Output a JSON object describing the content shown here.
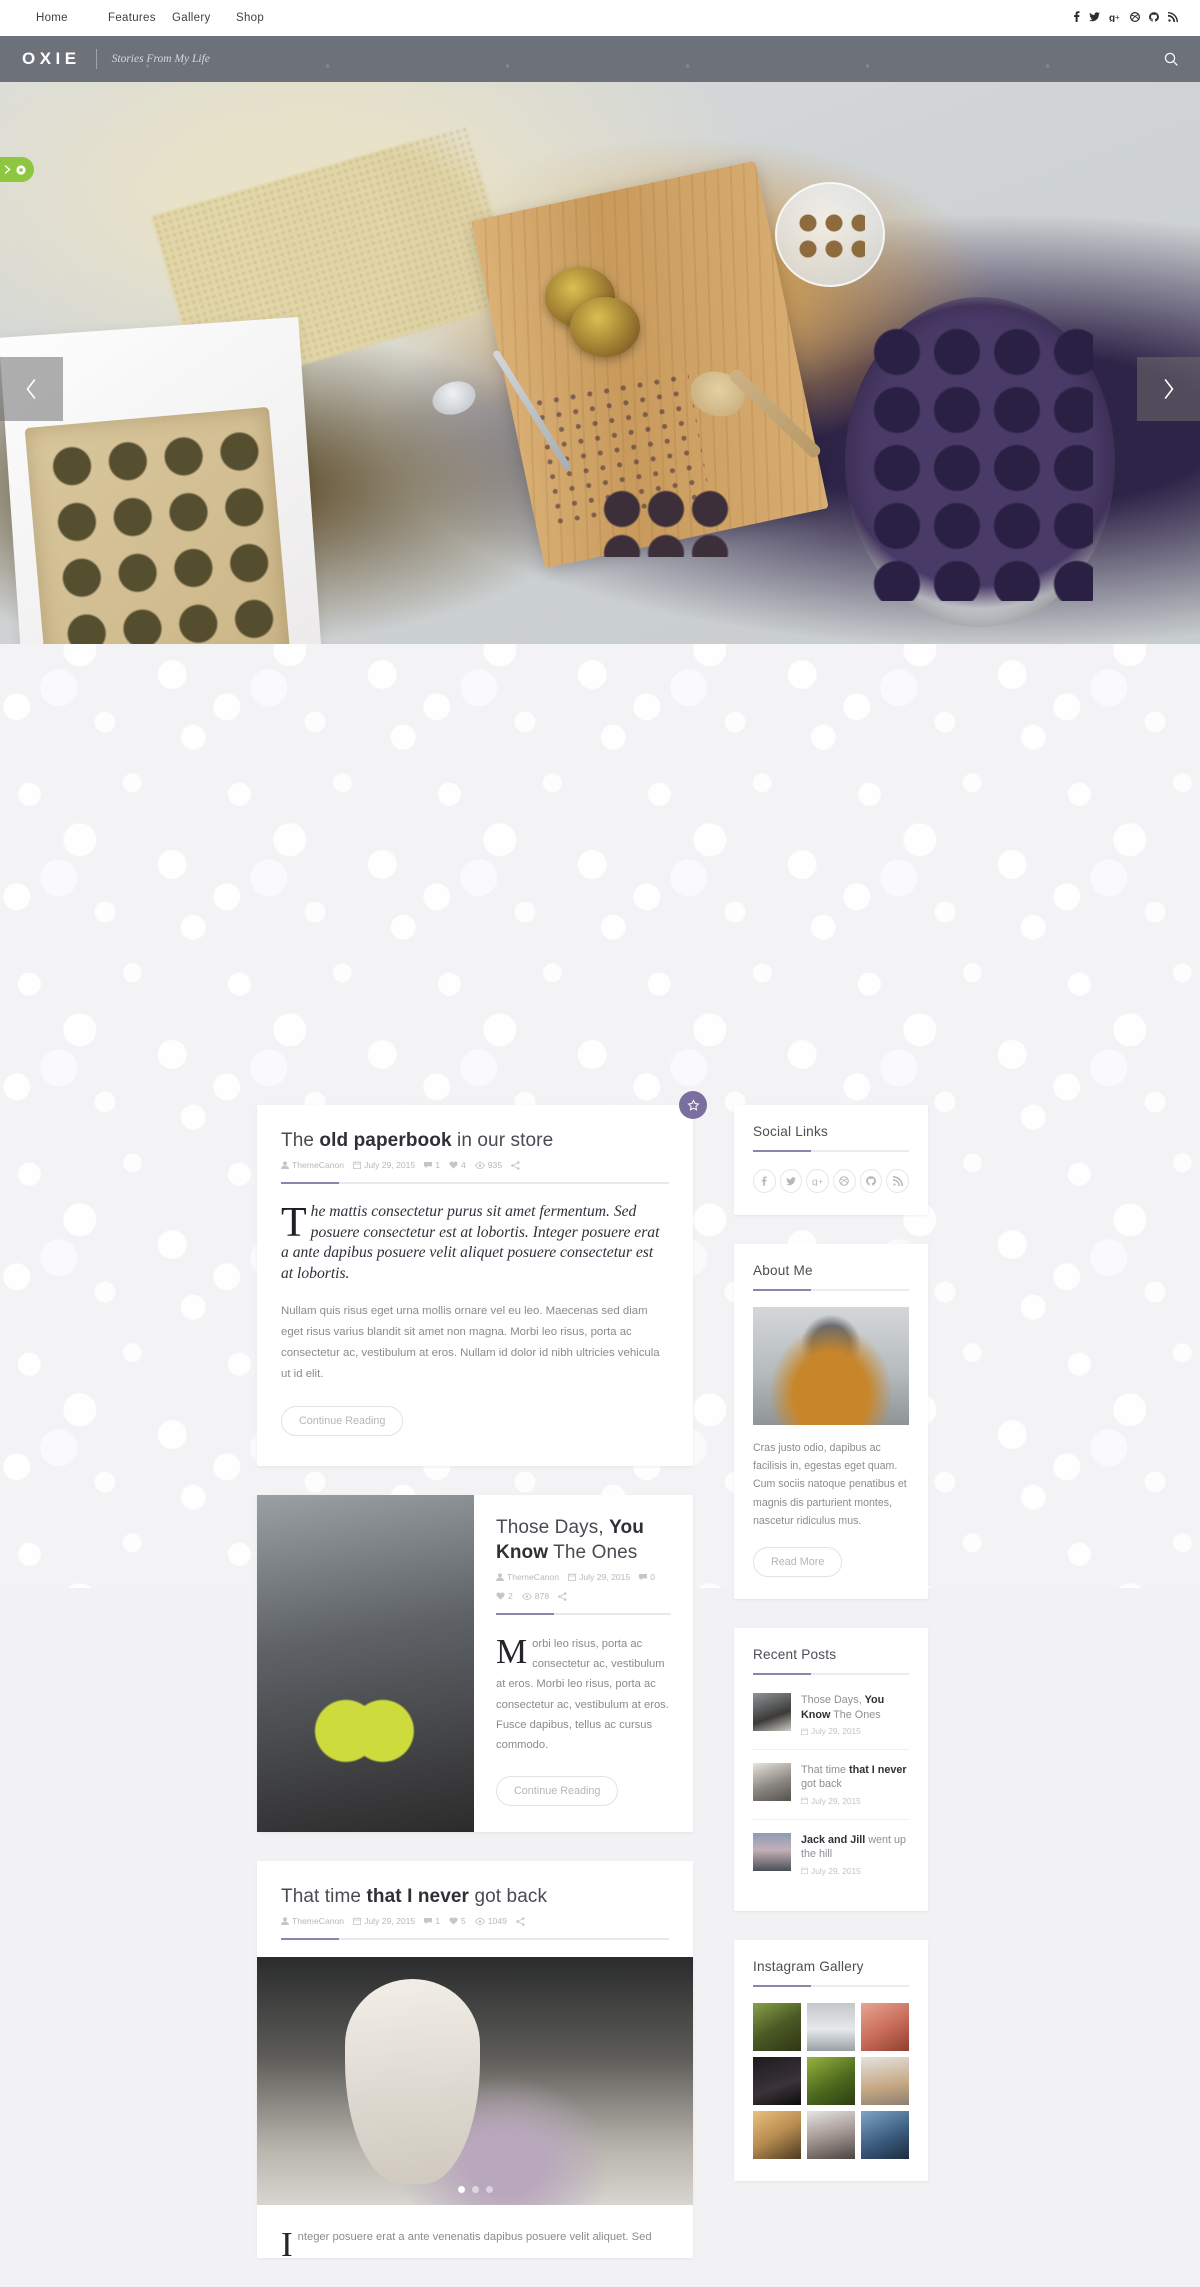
{
  "topnav": {
    "items": [
      {
        "label": "Home"
      },
      {
        "label": "Features"
      },
      {
        "label": "Gallery"
      },
      {
        "label": "Shop"
      }
    ],
    "social": [
      {
        "name": "facebook-icon",
        "glyph": "f"
      },
      {
        "name": "twitter-icon",
        "glyph": "ᵛ"
      },
      {
        "name": "google-plus-icon",
        "glyph": "g+"
      },
      {
        "name": "dribbble-icon",
        "glyph": "◉"
      },
      {
        "name": "github-icon",
        "glyph": "○"
      },
      {
        "name": "rss-icon",
        "glyph": "⤵"
      }
    ]
  },
  "header": {
    "logo": "OXIE",
    "tagline": "Stories From My Life",
    "search_label": "Search",
    "bg_color": "#6d7179"
  },
  "hero": {
    "prev_label": "Previous slide",
    "next_label": "Next slide",
    "theme_tab_label": "Theme options"
  },
  "accent_color": "#8b85ab",
  "posts": [
    {
      "title_plain_1": "The ",
      "title_bold": "old paperbook",
      "title_plain_2": " in our store",
      "author": "ThemeCanon",
      "date": "July 29, 2015",
      "comments": "1",
      "likes": "4",
      "views": "935",
      "dropcap": "T",
      "lead": "he mattis consectetur purus sit amet fermentum. Sed posuere consectetur est at lobortis. Integer posuere erat a ante dapibus posuere velit aliquet posuere consectetur est at lobortis.",
      "body": "Nullam quis risus eget urna mollis ornare vel eu leo. Maecenas sed diam eget risus varius blandit sit amet non magna. Morbi leo risus, porta ac consectetur ac, vestibulum at eros. Nullam id dolor id nibh ultricies vehicula ut id elit.",
      "button": "Continue Reading",
      "featured": "star-badge"
    },
    {
      "title_plain_1": "Those Days, ",
      "title_bold": "You Know",
      "title_plain_2": " The Ones",
      "author": "ThemeCanon",
      "date": "July 29, 2015",
      "comments": "0",
      "likes": "2",
      "views": "878",
      "dropcap": "M",
      "body": "orbi leo risus, porta ac consectetur ac, vestibulum at eros. Morbi leo risus, porta ac consectetur ac, vestibulum at eros. Fusce dapibus, tellus ac cursus commodo.",
      "button": "Continue Reading"
    },
    {
      "title_plain_1": "That time ",
      "title_bold": "that I never",
      "title_plain_2": " got back",
      "author": "ThemeCanon",
      "date": "July 29, 2015",
      "comments": "1",
      "likes": "5",
      "views": "1049",
      "dropcap": "I",
      "body": "nteger posuere erat a ante venenatis dapibus posuere velit aliquet. Sed",
      "slider_dots": 3,
      "slider_active": 0
    }
  ],
  "sidebar": {
    "social_links": {
      "title": "Social Links",
      "icons": [
        {
          "name": "facebook-icon",
          "glyph": "f"
        },
        {
          "name": "twitter-icon",
          "glyph": "ᵛ"
        },
        {
          "name": "google-plus-icon",
          "glyph": "g+"
        },
        {
          "name": "dribbble-icon",
          "glyph": "◎"
        },
        {
          "name": "github-icon",
          "glyph": "○"
        },
        {
          "name": "rss-icon",
          "glyph": "⤵"
        }
      ]
    },
    "about": {
      "title": "About Me",
      "text": "Cras justo odio, dapibus ac facilisis in, egestas eget quam. Cum sociis natoque penatibus et magnis dis parturient montes, nascetur ridiculus mus.",
      "button": "Read More",
      "image_alt": "person-in-orange-jacket"
    },
    "recent_posts": {
      "title": "Recent Posts",
      "items": [
        {
          "plain_1": "Those Days, ",
          "bold": "You Know",
          "plain_2": " The Ones",
          "date": "July 29, 2015"
        },
        {
          "plain_1": "That time ",
          "bold": "that I never",
          "plain_2": " got back",
          "date": "July 29, 2015"
        },
        {
          "plain_1": "",
          "bold": "Jack and Jill",
          "plain_2": " went up the hill",
          "date": "July 29, 2015"
        }
      ]
    },
    "instagram": {
      "title": "Instagram Gallery",
      "cells": [
        "dogs-in-field",
        "dog-on-skateboard",
        "pig-closeup",
        "person-in-dark-room",
        "lizard-on-leaf",
        "cat-by-window",
        "girl-dancing",
        "portrait-woman",
        "man-on-bus"
      ]
    }
  }
}
